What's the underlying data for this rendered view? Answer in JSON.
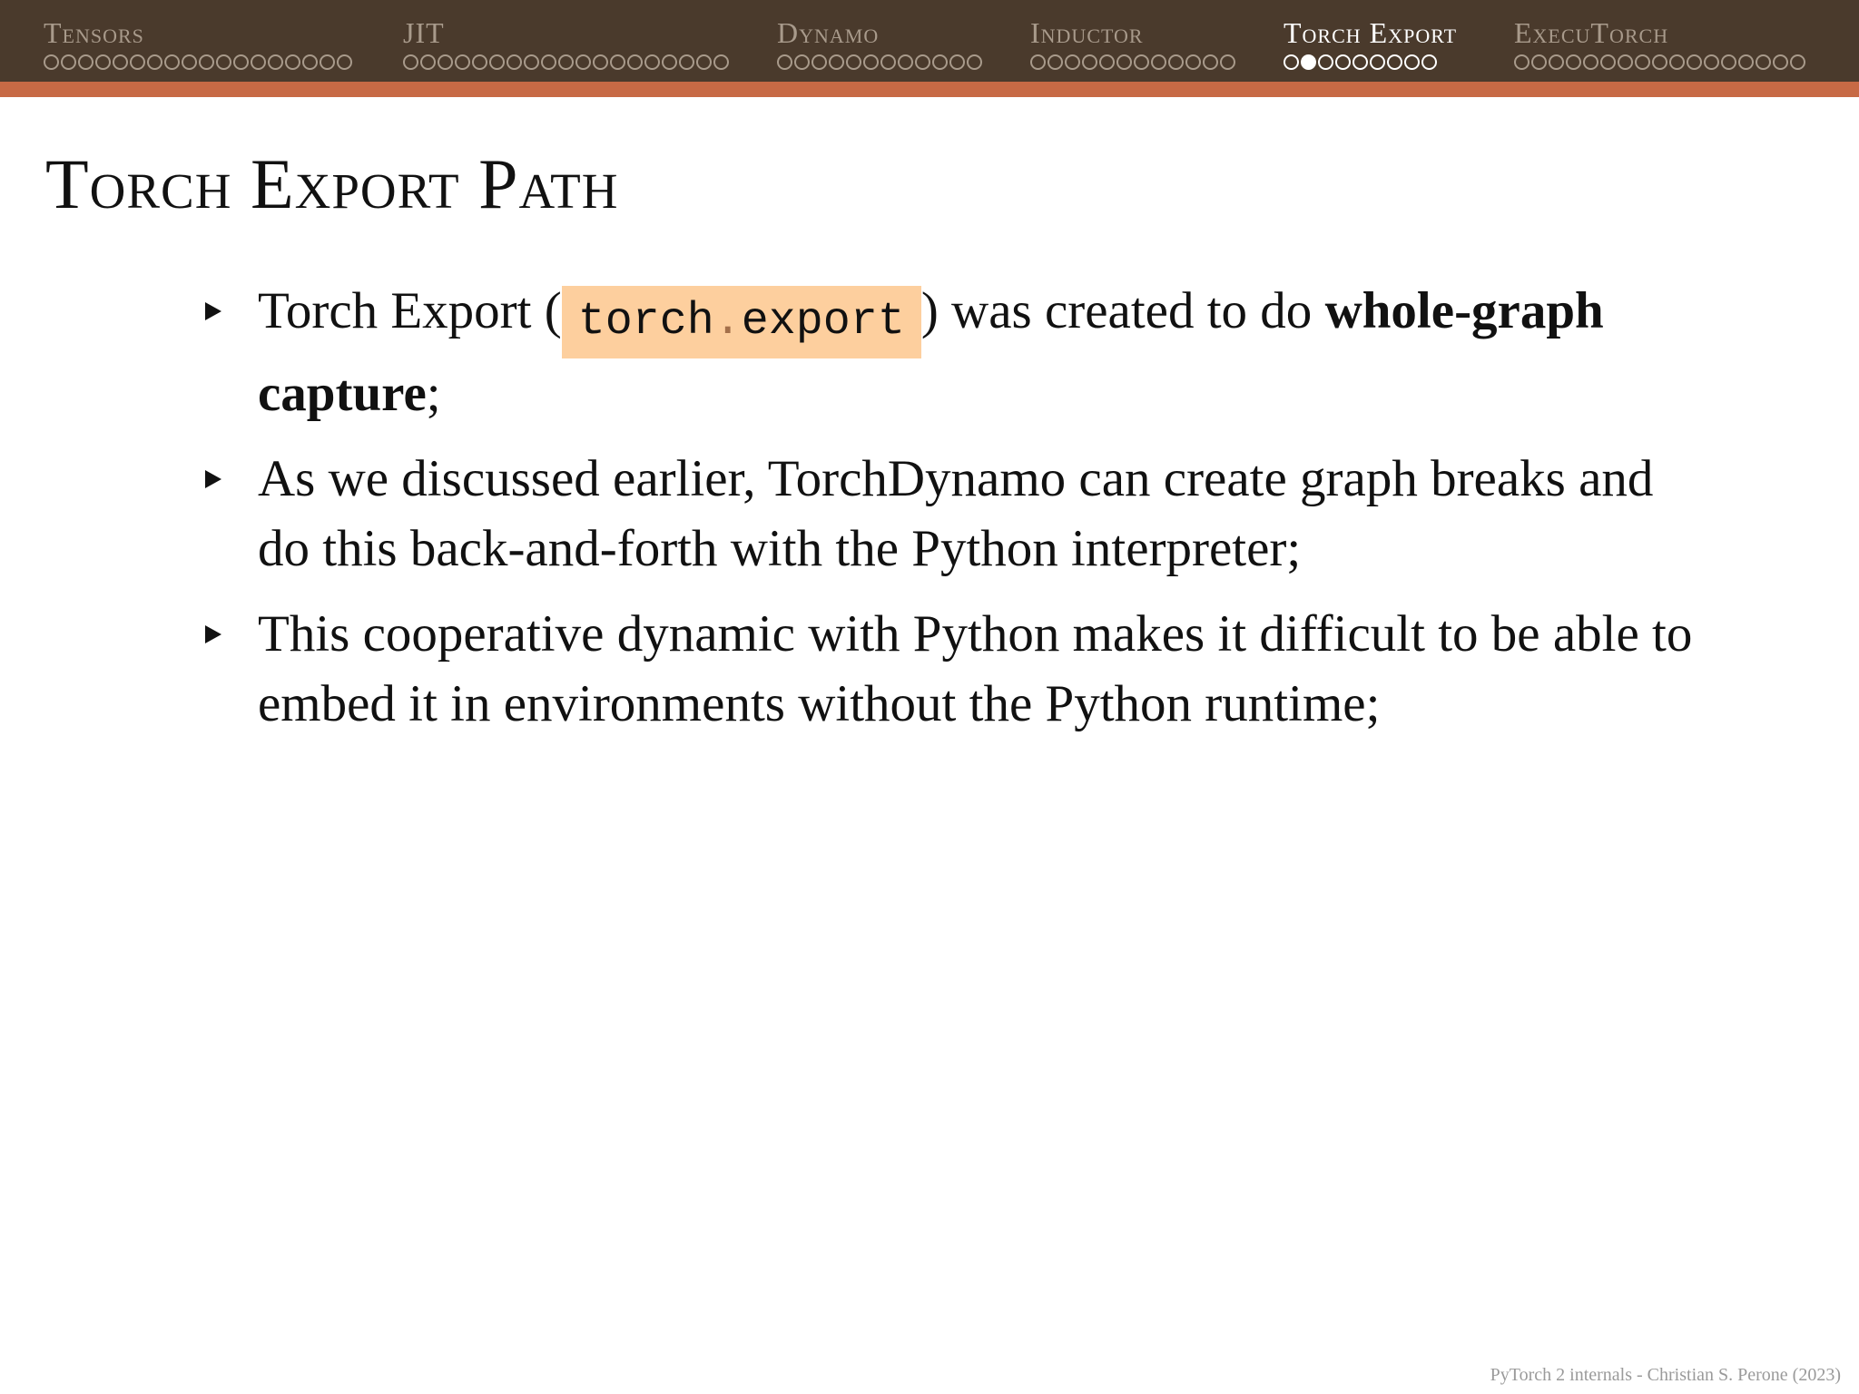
{
  "nav": {
    "sections": [
      {
        "title": "Tensors",
        "dots": 18,
        "filled": -1,
        "active": false
      },
      {
        "title": "JIT",
        "dots": 19,
        "filled": -1,
        "active": false
      },
      {
        "title": "Dynamo",
        "dots": 12,
        "filled": -1,
        "active": false
      },
      {
        "title": "Inductor",
        "dots": 12,
        "filled": -1,
        "active": false
      },
      {
        "title": "Torch Export",
        "dots": 9,
        "filled": 1,
        "active": true
      },
      {
        "title": "ExecuTorch",
        "dots": 17,
        "filled": -1,
        "active": false
      }
    ]
  },
  "slide": {
    "title": "Torch Export Path",
    "bullet1": {
      "before": "Torch Export (",
      "code_part1": "torch",
      "code_dot": ".",
      "code_part2": "export",
      "after": ") was created to do ",
      "bold": "whole-graph capture",
      "end": ";"
    },
    "bullet2": "As we discussed earlier, TorchDynamo can create graph breaks and do this back-and-forth with the Python interpreter;",
    "bullet3": "This cooperative dynamic with Python makes it difficult to be able to embed it in environments without the Python runtime;"
  },
  "footer": "PyTorch 2 internals - Christian S. Perone (2023)",
  "colors": {
    "header_bg": "#4a3a2c",
    "header_rule": "#c76a45",
    "code_highlight": "#fdcf9e"
  }
}
